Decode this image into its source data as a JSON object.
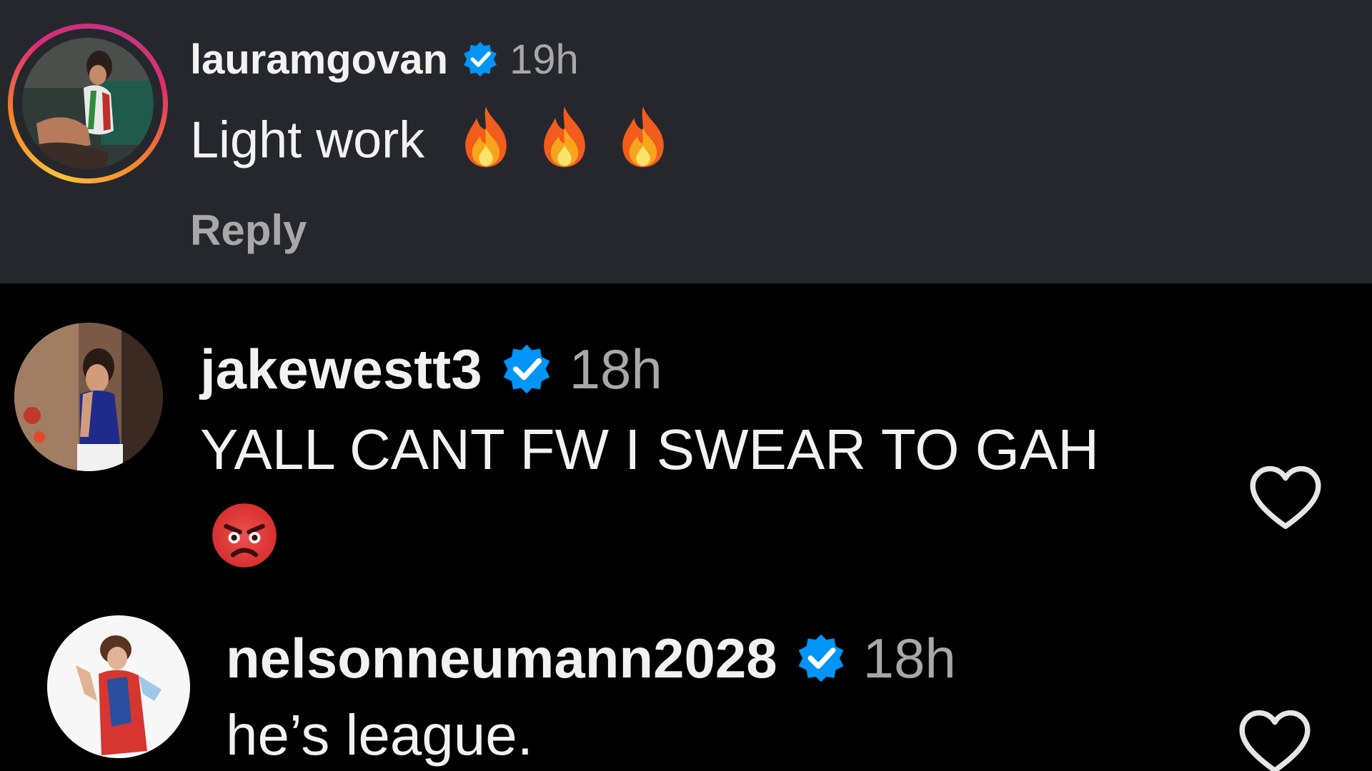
{
  "comments": [
    {
      "username": "lauramgovan",
      "verified": true,
      "time": "19h",
      "text": "Light work",
      "emojis": [
        "fire-emoji",
        "fire-emoji",
        "fire-emoji"
      ],
      "reply_label": "Reply",
      "has_story_ring": true,
      "highlighted": true
    },
    {
      "username": "jakewestt3",
      "verified": true,
      "time": "18h",
      "text": "YALL CANT FW I SWEAR TO GAH",
      "emojis": [
        "angry-face-emoji"
      ],
      "liked": false
    },
    {
      "username": "nelsonneumann2028",
      "verified": true,
      "time": "18h",
      "text": "he’s league.",
      "liked": false
    }
  ],
  "colors": {
    "highlight_background": "#25272c",
    "page_background": "#000000",
    "verified_blue": "#0095f6",
    "secondary_text": "#a8a8a8",
    "primary_text": "#f2f2f2"
  },
  "icons": {
    "verified": "verified-badge-icon",
    "like": "heart-outline-icon"
  }
}
